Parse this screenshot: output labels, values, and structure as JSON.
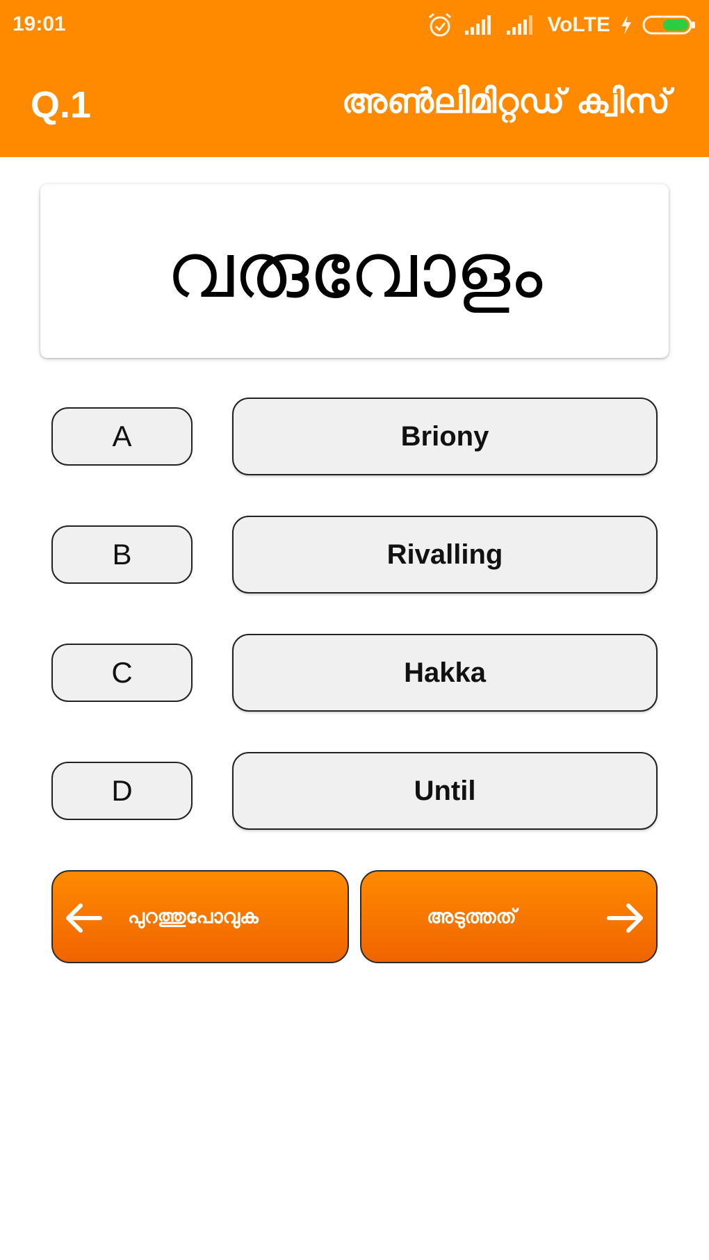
{
  "status_bar": {
    "time": "19:01",
    "network_label": "VoLTE"
  },
  "header": {
    "question_number": "Q.1",
    "title": "അൺലിമിറ്റഡ് ക്വിസ്"
  },
  "question": {
    "word": "വരുവോളം"
  },
  "options": [
    {
      "letter": "A",
      "answer": "Briony"
    },
    {
      "letter": "B",
      "answer": "Rivalling"
    },
    {
      "letter": "C",
      "answer": "Hakka"
    },
    {
      "letter": "D",
      "answer": "Until"
    }
  ],
  "navigation": {
    "back_label": "പുറത്തുപോവുക",
    "next_label": "അടുത്തത്"
  },
  "colors": {
    "header_bg": "#ff8a00",
    "button_gradient_top": "#ff8a00",
    "button_gradient_bottom": "#ef6400",
    "option_bg": "#f0f0f0",
    "battery_fill": "#2ecc40"
  },
  "icons": {
    "alarm": "alarm-icon",
    "signal_1": "signal-bars-icon",
    "signal_2": "signal-bars-icon",
    "charging": "charging-bolt-icon",
    "battery": "battery-icon",
    "back": "arrow-left-icon",
    "next": "arrow-right-icon"
  }
}
